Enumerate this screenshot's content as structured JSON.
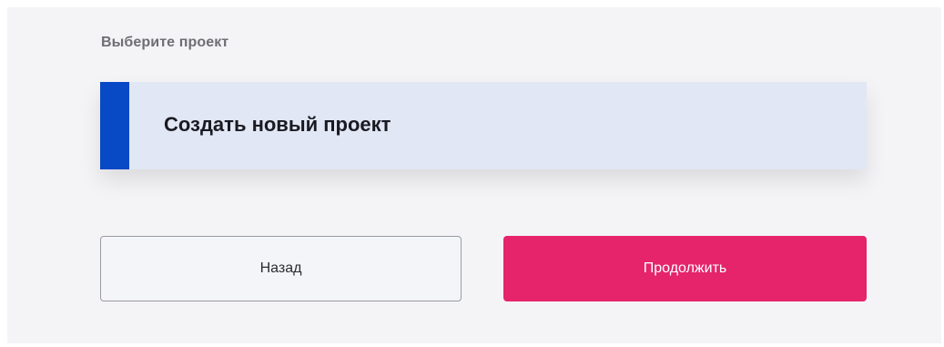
{
  "step": {
    "label": "Выберите проект"
  },
  "project_option": {
    "title": "Создать новый проект"
  },
  "actions": {
    "back_label": "Назад",
    "continue_label": "Продолжить"
  },
  "colors": {
    "accent_blue": "#0849c6",
    "card_background": "#e1e7f4",
    "primary_button": "#e5246b",
    "panel_background": "#f4f4f6"
  }
}
